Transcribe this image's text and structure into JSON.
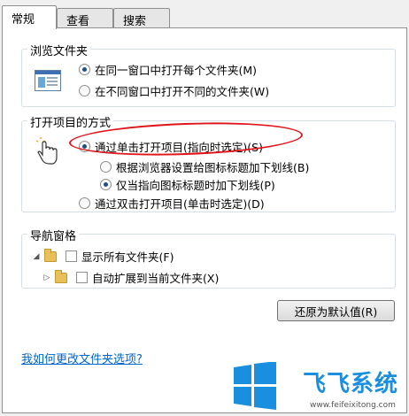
{
  "tabs": [
    "常规",
    "查看",
    "搜索"
  ],
  "browse_folders": {
    "title": "浏览文件夹",
    "icon": "window-preview-icon",
    "options": [
      "在同一窗口中打开每个文件夹(M)",
      "在不同窗口中打开不同的文件夹(W)"
    ],
    "selected": 0
  },
  "click_items": {
    "title": "打开项目的方式",
    "icon": "hand-cursor-icon",
    "options": [
      "通过单击打开项目(指向时选定)(S)",
      "通过双击打开项目(单击时选定)(D)"
    ],
    "sub_options": [
      "根据浏览器设置给图标标题加下划线(B)",
      "仅当指向图标标题时加下划线(P)"
    ],
    "selected": 0,
    "sub_selected": 1
  },
  "nav_pane": {
    "title": "导航窗格",
    "options": [
      "显示所有文件夹(F)",
      "自动扩展到当前文件夹(X)"
    ]
  },
  "restore_button": "还原为默认值(R)",
  "help_link": "我如何更改文件夹选项?",
  "watermark": {
    "brand": "飞飞系统",
    "url": "www.feifeixitong.com",
    "colors": {
      "primary": "#1a8fe0"
    }
  },
  "highlight_color": "#e0141b"
}
